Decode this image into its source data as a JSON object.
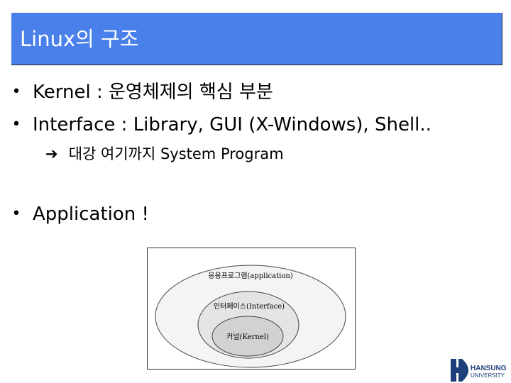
{
  "slide": {
    "title": "Linux의 구조",
    "bullets": [
      "Kernel : 운영체제의 핵심 부분",
      "Interface : Library, GUI (X-Windows), Shell..",
      "Application !"
    ],
    "bullet_marker": "•",
    "sub_arrow": "➔",
    "sub_bullet": "대강 여기까지 System Program"
  },
  "diagram": {
    "outer_label": "응용프로그램(application)",
    "middle_label": "인터페이스(Interface)",
    "inner_label": "커널(Kernel)"
  },
  "logo": {
    "line1": "HANSUNG",
    "line2": "UNIVERSITY",
    "color": "#1f3f7a"
  },
  "colors": {
    "title_bar": "#4a80ea",
    "outer_ellipse": "#f4f4f4",
    "middle_ellipse": "#e4e4e4",
    "inner_ellipse": "#d2d2d2"
  }
}
